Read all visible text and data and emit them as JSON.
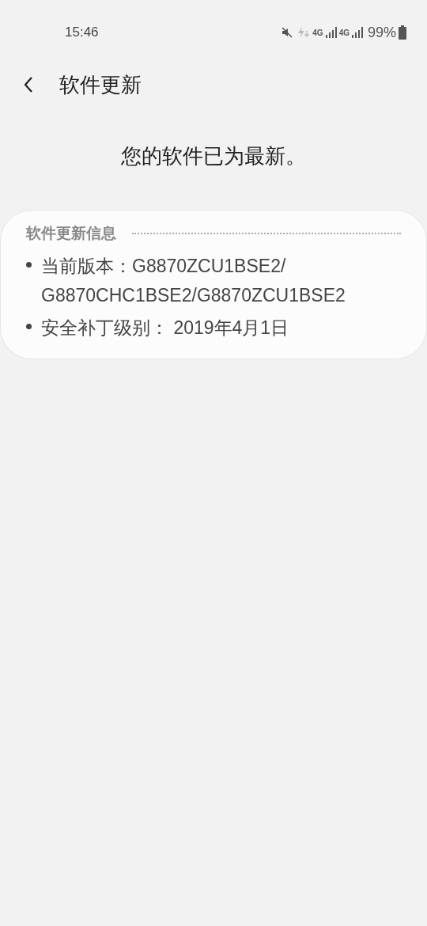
{
  "status_bar": {
    "time": "15:46",
    "network_labels": [
      "4G",
      "4G"
    ],
    "battery": "99%"
  },
  "header": {
    "title": "软件更新"
  },
  "message": "您的软件已为最新。",
  "info_card": {
    "title": "软件更新信息",
    "items": [
      "当前版本：G8870ZCU1BSE2/ G8870CHC1BSE2/G8870ZCU1BSE2",
      "安全补丁级别： 2019年4月1日"
    ]
  }
}
